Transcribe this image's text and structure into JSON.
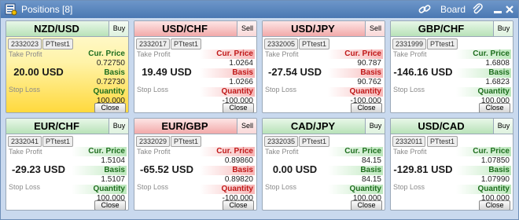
{
  "window": {
    "title": "Positions [8]",
    "board_label": "Board"
  },
  "labels": {
    "take_profit": "Take Profit",
    "stop_loss": "Stop Loss",
    "cur_price": "Cur. Price",
    "basis": "Basis",
    "quantity": "Quantity",
    "close": "Close"
  },
  "colors": {
    "buy_header": "#b8e2b8",
    "sell_header": "#f2a9a9",
    "highlight": "#ffd93d",
    "title_bar": "#4a78b3"
  },
  "positions": [
    {
      "pair": "NZD/USD",
      "side": "Buy",
      "id": "2332023",
      "account": "PTtest1",
      "pnl": "20.00 USD",
      "cur_price": "0.72750",
      "basis": "0.72730",
      "quantity": "100,000"
    },
    {
      "pair": "USD/CHF",
      "side": "Sell",
      "id": "2332017",
      "account": "PTtest1",
      "pnl": "19.49 USD",
      "cur_price": "1.0264",
      "basis": "1.0266",
      "quantity": "-100,000"
    },
    {
      "pair": "USD/JPY",
      "side": "Sell",
      "id": "2332005",
      "account": "PTtest1",
      "pnl": "-27.54 USD",
      "cur_price": "90.787",
      "basis": "90.762",
      "quantity": "-100,000"
    },
    {
      "pair": "GBP/CHF",
      "side": "Buy",
      "id": "2331999",
      "account": "PTtest1",
      "pnl": "-146.16 USD",
      "cur_price": "1.6808",
      "basis": "1.6823",
      "quantity": "100,000"
    },
    {
      "pair": "EUR/CHF",
      "side": "Buy",
      "id": "2332041",
      "account": "PTtest1",
      "pnl": "-29.23 USD",
      "cur_price": "1.5104",
      "basis": "1.5107",
      "quantity": "100,000"
    },
    {
      "pair": "EUR/GBP",
      "side": "Sell",
      "id": "2332029",
      "account": "PTtest1",
      "pnl": "-65.52 USD",
      "cur_price": "0.89860",
      "basis": "0.89820",
      "quantity": "-100,000"
    },
    {
      "pair": "CAD/JPY",
      "side": "Buy",
      "id": "2332035",
      "account": "PTtest1",
      "pnl": "0.00 USD",
      "cur_price": "84.15",
      "basis": "84.15",
      "quantity": "100,000"
    },
    {
      "pair": "USD/CAD",
      "side": "Buy",
      "id": "2332011",
      "account": "PTtest1",
      "pnl": "-129.81 USD",
      "cur_price": "1.07850",
      "basis": "1.07990",
      "quantity": "100,000"
    }
  ]
}
